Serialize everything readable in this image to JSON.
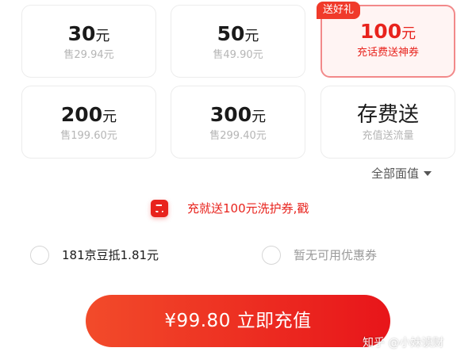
{
  "cards": [
    {
      "amount": "30",
      "unit": "元",
      "sub": "售29.94元"
    },
    {
      "amount": "50",
      "unit": "元",
      "sub": "售49.90元"
    },
    {
      "amount": "100",
      "unit": "元",
      "sub": "充话费送神券",
      "badge": "送好礼",
      "selected": true
    },
    {
      "amount": "200",
      "unit": "元",
      "sub": "售199.60元"
    },
    {
      "amount": "300",
      "unit": "元",
      "sub": "售299.40元"
    },
    {
      "amount": "存费送",
      "unit": "",
      "sub": "充值送流量"
    }
  ],
  "all_values": {
    "label": "全部面值"
  },
  "promo": {
    "text": "充就送100元洗护券,戳"
  },
  "options": {
    "beans": {
      "label": "181京豆抵1.81元"
    },
    "coupon": {
      "label": "暂无可用优惠券"
    }
  },
  "pay_button": {
    "label": "¥99.80 立即充值"
  },
  "watermark": {
    "text": "知乎 @小妹读财"
  },
  "colors": {
    "accent": "#e8231d",
    "selected_border": "#f2898a",
    "selected_bg": "#fff4f3"
  }
}
